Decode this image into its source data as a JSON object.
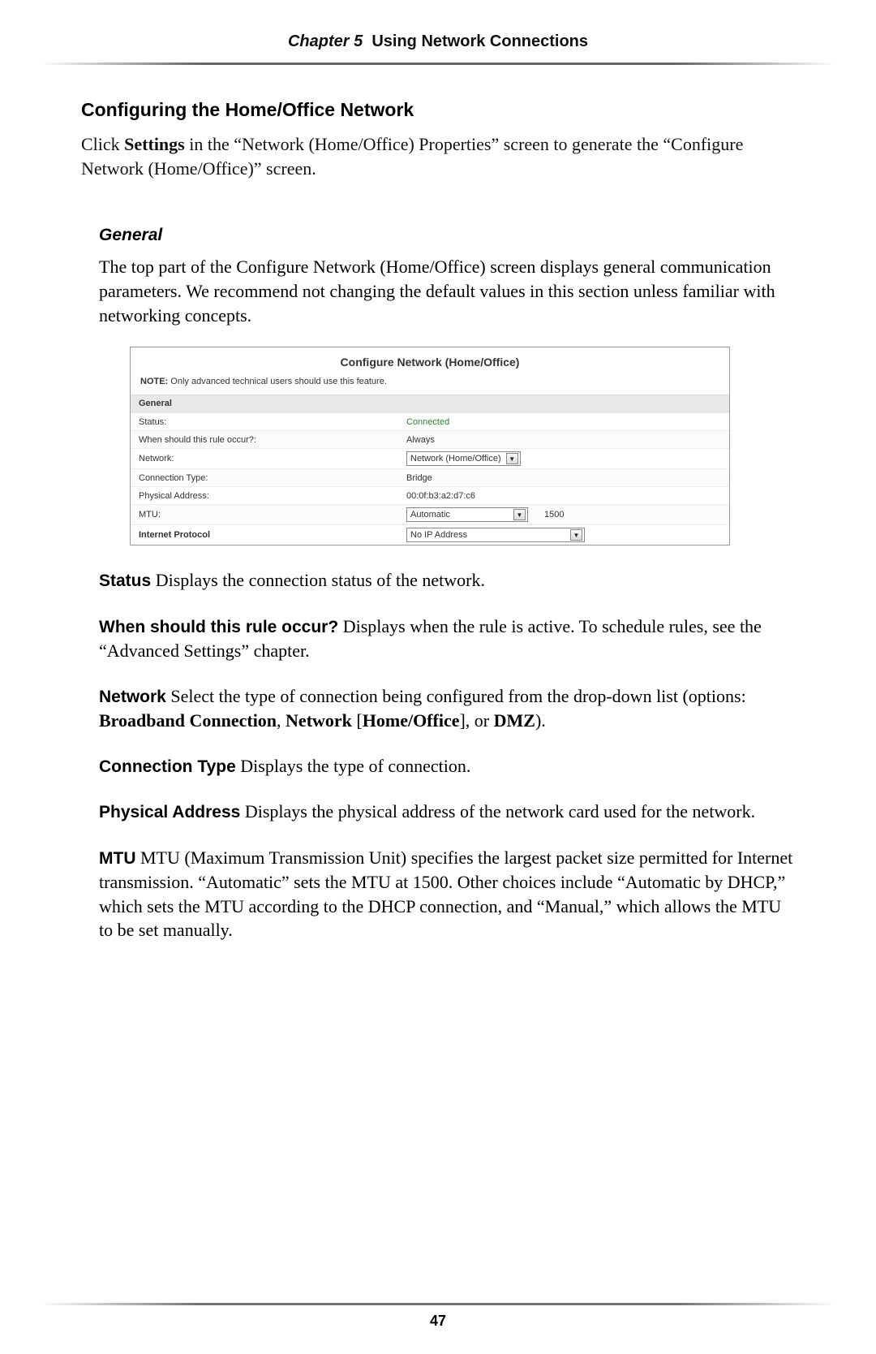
{
  "header": {
    "chapter": "Chapter 5",
    "title": "Using Network Connections"
  },
  "h1": "Configuring the Home/Office Network",
  "intro_parts": {
    "p1": "Click ",
    "b1": "Settings",
    "p2": " in the “Network (Home/Office) Properties” screen to generate the “Configure Network (Home/Office)” screen."
  },
  "general_heading": "General",
  "general_body": "The top part of the Configure Network (Home/Office) screen displays general communication parameters. We recommend not changing the default values in this section unless familiar with networking concepts.",
  "panel": {
    "title": "Configure Network (Home/Office)",
    "note_label": "NOTE:",
    "note_text": " Only advanced technical users should use this feature.",
    "section_general": "General",
    "rows": {
      "status_label": "Status:",
      "status_value": "Connected",
      "rule_label": "When should this rule occur?:",
      "rule_value": "Always",
      "network_label": "Network:",
      "network_select": "Network (Home/Office)",
      "conntype_label": "Connection Type:",
      "conntype_value": "Bridge",
      "phys_label": "Physical Address:",
      "phys_value": "00:0f:b3:a2:d7:c6",
      "mtu_label": "MTU:",
      "mtu_select": "Automatic",
      "mtu_num": "1500",
      "ip_label": "Internet Protocol",
      "ip_select": "No IP Address"
    }
  },
  "defs": {
    "status_term": "Status",
    "status_text": "  Displays the connection status of the network.",
    "rule_term": "When should this rule occur?",
    "rule_text": "  Displays when the rule is active. To schedule rules, see the “Advanced Settings” chapter.",
    "network_term": "Network",
    "network_p1": "  Select the type of connection being configured from the drop-down list (options: ",
    "network_b1": "Broadband Connection",
    "network_p2": ", ",
    "network_b2": "Network",
    "network_p3": " [",
    "network_b3": "Home/Office",
    "network_p4": "], or ",
    "network_b4": "DMZ",
    "network_p5": ").",
    "conntype_term": "Connection Type",
    "conntype_text": "  Displays the type of connection.",
    "phys_term": "Physical Address",
    "phys_text": "  Displays the physical address of the network card used for the network.",
    "mtu_term": "MTU",
    "mtu_text": "  MTU (Maximum Transmission Unit) specifies the largest packet size permitted for Internet transmission. “Automatic” sets the MTU at 1500. Other choices include “Automatic by DHCP,” which sets the MTU according to the DHCP connection, and “Manual,” which allows the MTU to be set manually."
  },
  "page_number": "47"
}
